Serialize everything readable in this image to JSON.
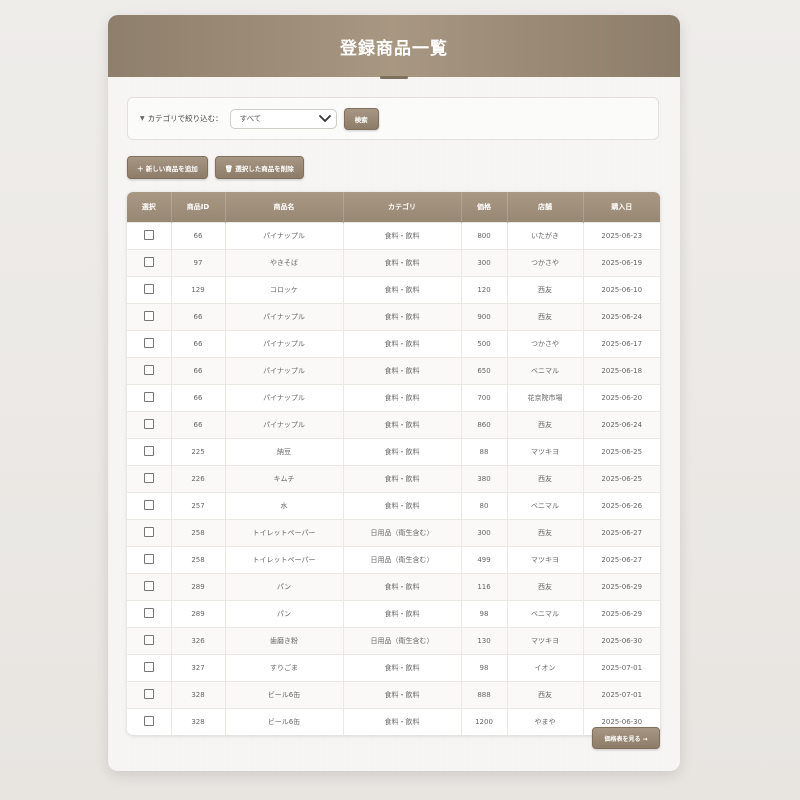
{
  "page": {
    "title": "登録商品一覧"
  },
  "filter": {
    "label": "カテゴリで絞り込む：",
    "selected": "すべて",
    "search_button": "検索"
  },
  "actions": {
    "add_button": "＋ 新しい商品を追加",
    "delete_button": "🗑 選択した商品を削除"
  },
  "table": {
    "headers": [
      "選択",
      "商品ID",
      "商品名",
      "カテゴリ",
      "価格",
      "店舗",
      "購入日"
    ],
    "rows": [
      {
        "id": "66",
        "name": "パイナップル",
        "category": "食料・飲料",
        "price": "800",
        "store": "いたがき",
        "date": "2025-06-23"
      },
      {
        "id": "97",
        "name": "やきそば",
        "category": "食料・飲料",
        "price": "300",
        "store": "つかさや",
        "date": "2025-06-19"
      },
      {
        "id": "129",
        "name": "コロッケ",
        "category": "食料・飲料",
        "price": "120",
        "store": "西友",
        "date": "2025-06-10"
      },
      {
        "id": "66",
        "name": "パイナップル",
        "category": "食料・飲料",
        "price": "900",
        "store": "西友",
        "date": "2025-06-24"
      },
      {
        "id": "66",
        "name": "パイナップル",
        "category": "食料・飲料",
        "price": "500",
        "store": "つかさや",
        "date": "2025-06-17"
      },
      {
        "id": "66",
        "name": "パイナップル",
        "category": "食料・飲料",
        "price": "650",
        "store": "ベニマル",
        "date": "2025-06-18"
      },
      {
        "id": "66",
        "name": "パイナップル",
        "category": "食料・飲料",
        "price": "700",
        "store": "花京院市場",
        "date": "2025-06-20"
      },
      {
        "id": "66",
        "name": "パイナップル",
        "category": "食料・飲料",
        "price": "860",
        "store": "西友",
        "date": "2025-06-24"
      },
      {
        "id": "225",
        "name": "納豆",
        "category": "食料・飲料",
        "price": "88",
        "store": "マツキヨ",
        "date": "2025-06-25"
      },
      {
        "id": "226",
        "name": "キムチ",
        "category": "食料・飲料",
        "price": "380",
        "store": "西友",
        "date": "2025-06-25"
      },
      {
        "id": "257",
        "name": "水",
        "category": "食料・飲料",
        "price": "80",
        "store": "ベニマル",
        "date": "2025-06-26"
      },
      {
        "id": "258",
        "name": "トイレットペーパー",
        "category": "日用品（衛生含む）",
        "price": "300",
        "store": "西友",
        "date": "2025-06-27"
      },
      {
        "id": "258",
        "name": "トイレットペーパー",
        "category": "日用品（衛生含む）",
        "price": "499",
        "store": "マツキヨ",
        "date": "2025-06-27"
      },
      {
        "id": "289",
        "name": "パン",
        "category": "食料・飲料",
        "price": "116",
        "store": "西友",
        "date": "2025-06-29"
      },
      {
        "id": "289",
        "name": "パン",
        "category": "食料・飲料",
        "price": "98",
        "store": "ベニマル",
        "date": "2025-06-29"
      },
      {
        "id": "326",
        "name": "歯磨き粉",
        "category": "日用品（衛生含む）",
        "price": "130",
        "store": "マツキヨ",
        "date": "2025-06-30"
      },
      {
        "id": "327",
        "name": "すりごま",
        "category": "食料・飲料",
        "price": "98",
        "store": "イオン",
        "date": "2025-07-01"
      },
      {
        "id": "328",
        "name": "ビール6缶",
        "category": "食料・飲料",
        "price": "888",
        "store": "西友",
        "date": "2025-07-01"
      },
      {
        "id": "328",
        "name": "ビール6缶",
        "category": "食料・飲料",
        "price": "1200",
        "store": "やまや",
        "date": "2025-06-30"
      }
    ]
  },
  "footer": {
    "price_table_button": "価格表を見る →"
  },
  "colors": {
    "accent": "#9a8a76",
    "header_gradient_start": "#8e7f6c",
    "header_gradient_mid": "#a89781"
  }
}
